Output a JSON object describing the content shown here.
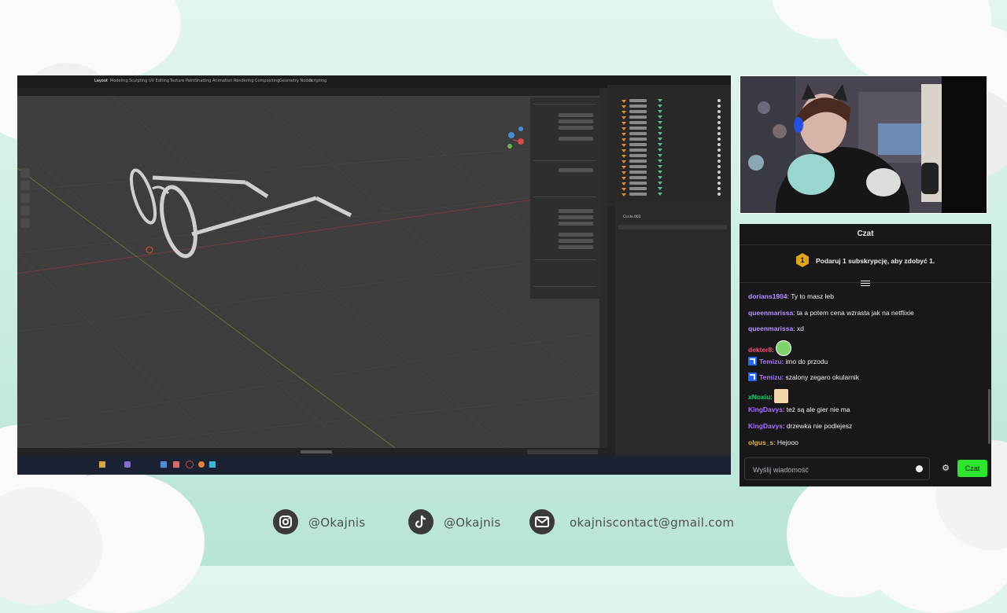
{
  "colors": {
    "background": "#c9ece1",
    "chat_bg": "#18181b",
    "chat_button": "#2ee62e",
    "gift_badge": "#e0a319"
  },
  "blender": {
    "workspace_tabs": [
      "Layout",
      "Modeling",
      "Sculpting",
      "UV Editing",
      "Texture Paint",
      "Shading",
      "Animation",
      "Rendering",
      "Compositing",
      "Geometry Nodes",
      "Scripting"
    ],
    "active_tab": "Layout",
    "object_name": "Circle.001"
  },
  "chat": {
    "title": "Czat",
    "gift_badge_number": "1",
    "gift_text": "Podaruj 1 subskrypcję, aby zdobyć 1.",
    "messages": [
      {
        "user": "dorians1904",
        "color": "#b690ff",
        "text": "Ty to masz łeb"
      },
      {
        "user": "queenmarissa",
        "color": "#b690ff",
        "text": "ta a potem cena wzrasta jak na netflixie"
      },
      {
        "user": "queenmarissa",
        "color": "#b690ff",
        "text": "xd"
      },
      {
        "user": "dekter8",
        "color": "#ff4f6a",
        "text": ""
      },
      {
        "user": "Temizu",
        "color": "#a970ff",
        "text": "imo do przodu"
      },
      {
        "user": "Temizu",
        "color": "#a970ff",
        "text": "szalony zegaro okularnik"
      },
      {
        "user": "xNoxiu",
        "color": "#21d66b",
        "text": ""
      },
      {
        "user": "KingDavys",
        "color": "#a970ff",
        "text": "też są ale gier nie ma"
      },
      {
        "user": "KingDavys",
        "color": "#a970ff",
        "text": "drzewka nie podlejesz"
      },
      {
        "user": "olgus_s",
        "color": "#e8b43a",
        "text": "Hejooo"
      }
    ],
    "input_placeholder": "Wyślij wiadomość",
    "send_label": "Czat"
  },
  "socials": {
    "instagram": "@Okajnis",
    "tiktok": "@Okajnis",
    "email": "okajniscontact@gmail.com"
  }
}
